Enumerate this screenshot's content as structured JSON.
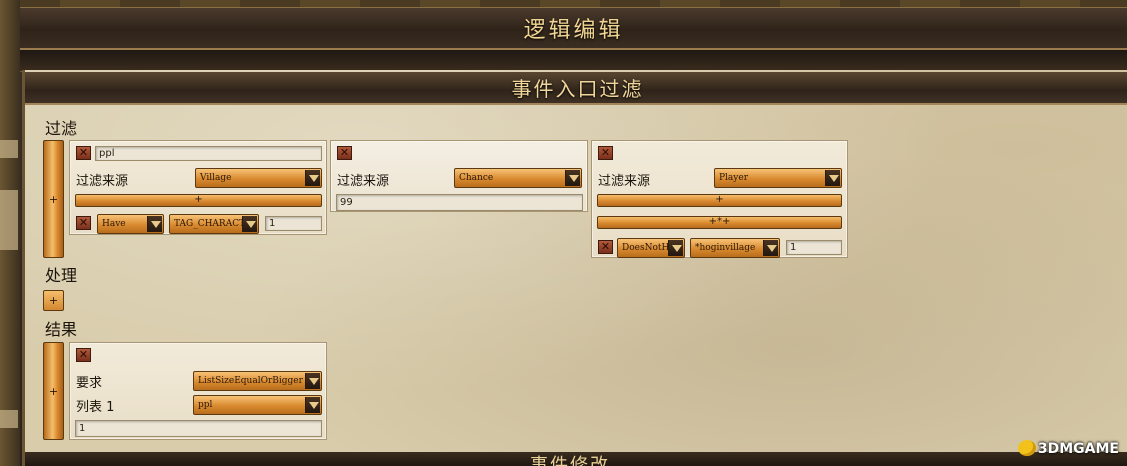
{
  "window": {
    "title": "逻辑编辑"
  },
  "section": {
    "title": "事件入口过滤",
    "next_title": "事件修改"
  },
  "filter": {
    "heading": "过滤",
    "add_label": "+",
    "cards": [
      {
        "name_value": "ppl",
        "source_label": "过滤来源",
        "source_value": "Village",
        "add_label": "+",
        "condition": {
          "op": "Have",
          "tag": "TAG_CHARACT",
          "count": "1"
        }
      },
      {
        "source_label": "过滤来源",
        "source_value": "Chance",
        "value": "99"
      },
      {
        "source_label": "过滤来源",
        "source_value": "Player",
        "add_label": "+",
        "add_star_label": "+*+",
        "condition": {
          "op": "DoesNotH",
          "tag": "*hoginvillage",
          "count": "1"
        }
      }
    ]
  },
  "process": {
    "heading": "处理",
    "add_label": "+"
  },
  "result": {
    "heading": "结果",
    "add_label": "+",
    "card": {
      "require_label": "要求",
      "require_value": "ListSizeEqualOrBigger",
      "list_label": "列表 1",
      "list_value": "ppl",
      "value": "1"
    }
  },
  "watermark": {
    "text": "3DMGAME"
  },
  "colors": {
    "accent": "#d98a2f",
    "title_text": "#f2d593",
    "parchment": "#d8ccab",
    "delete": "#9b4428"
  },
  "icons": {
    "delete": "close-icon",
    "dropdown": "chevron-down-icon",
    "watermark": "smiley-icon"
  }
}
